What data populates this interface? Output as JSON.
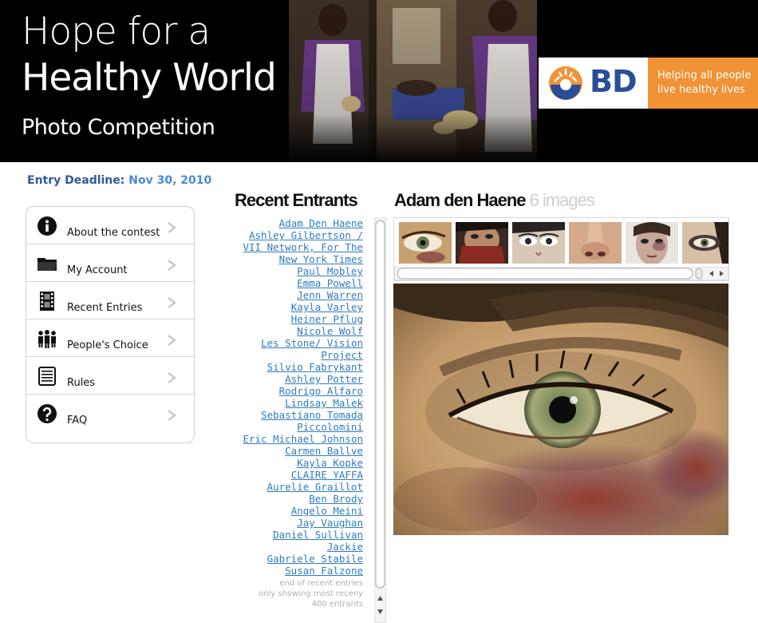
{
  "header": {
    "title_line1": "Hope for a",
    "title_line2": "Healthy World",
    "subtitle": "Photo Competition",
    "sponsor_logo_text": "BD",
    "sponsor_tagline_line1": "Helping all people",
    "sponsor_tagline_line2": "live healthy lives"
  },
  "deadline": {
    "label": "Entry Deadline:",
    "value": "Nov 30, 2010"
  },
  "menu": {
    "items": [
      {
        "label": "About the contest",
        "icon": "info-icon"
      },
      {
        "label": "My Account",
        "icon": "folder-icon"
      },
      {
        "label": "Recent Entries",
        "icon": "film-icon"
      },
      {
        "label": "People's Choice",
        "icon": "people-icon"
      },
      {
        "label": "Rules",
        "icon": "document-icon"
      },
      {
        "label": "FAQ",
        "icon": "question-icon"
      }
    ]
  },
  "recent_entrants": {
    "title": "Recent Entrants",
    "names": [
      "Adam Den Haene",
      "Ashley Gilbertson / VII Network, For The New York Times",
      "Paul Mobley",
      "Emma Powell",
      "Jenn Warren",
      "Kayla Varley",
      "Heiner Pflug",
      "Nicole Wolf",
      "Les Stone/ Vision Project",
      "Silvio Fabrykant",
      "Ashley Potter",
      "Rodrigo Alfaro",
      "Lindsay Malek",
      "Sebastiano Tomada Piccolomini",
      "Eric Michael Johnson",
      "Carmen Ballve",
      "Kayla Kopke",
      "CLAIRE YAFFA",
      "Aurelie Graillot",
      "Ben Brody",
      "Angelo Meini",
      "Jay Vaughan",
      "Daniel Sullivan",
      "Jackie",
      "Gabriele Stabile",
      "Susan Falzone"
    ],
    "ellipsis": "...",
    "footer_line1": "end of recent entries",
    "footer_line2": "only showing most receny",
    "footer_line3": "400 entrants"
  },
  "gallery": {
    "entrant_name": "Adam den Haene",
    "image_count": "6 images",
    "thumbnails": [
      "bruised-eye",
      "veiled-face",
      "woman-eyes",
      "nose-closeup",
      "bruised-face",
      "dark-eye"
    ]
  },
  "colors": {
    "banner_bg": "#000000",
    "brand_blue": "#2a4e96",
    "brand_orange": "#f09235",
    "link": "#2f7bbf",
    "deadline_label": "#2c5a98",
    "deadline_value": "#4a8ad0"
  }
}
